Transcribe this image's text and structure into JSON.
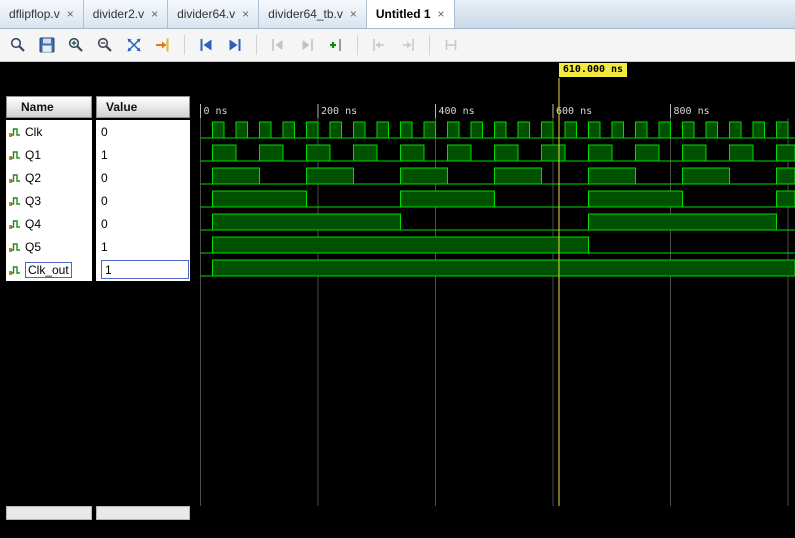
{
  "ui": {
    "close_glyph": "×"
  },
  "tabs": [
    {
      "label": "dflipflop.v",
      "active": false
    },
    {
      "label": "divider2.v",
      "active": false
    },
    {
      "label": "divider64.v",
      "active": false
    },
    {
      "label": "divider64_tb.v",
      "active": false
    },
    {
      "label": "Untitled 1",
      "active": true
    }
  ],
  "toolbar": {
    "items": [
      {
        "icon": "search-icon"
      },
      {
        "icon": "save-icon"
      },
      {
        "icon": "zoom-in-icon"
      },
      {
        "icon": "zoom-out-icon"
      },
      {
        "icon": "zoom-to-full-icon"
      },
      {
        "icon": "goto-time-cursor-icon"
      },
      {
        "sep": true
      },
      {
        "icon": "prev-transition-icon"
      },
      {
        "icon": "next-transition-icon"
      },
      {
        "sep": true
      },
      {
        "icon": "prev-marker-icon",
        "disabled": true
      },
      {
        "icon": "next-marker-icon",
        "disabled": true
      },
      {
        "icon": "add-marker-icon"
      },
      {
        "sep": true
      },
      {
        "icon": "goto-prev-cursor-icon",
        "disabled": true
      },
      {
        "icon": "goto-next-cursor-icon",
        "disabled": true
      },
      {
        "sep": true
      },
      {
        "icon": "swap-cursors-icon",
        "disabled": true
      }
    ]
  },
  "panel": {
    "name_header": "Name",
    "value_header": "Value"
  },
  "signals": [
    {
      "name": "Clk",
      "value": "0",
      "editing": false,
      "wave": {
        "init": 0,
        "first_toggle_ns": 20,
        "toggle_interval_ns": 20
      }
    },
    {
      "name": "Q1",
      "value": "1",
      "editing": false,
      "wave": {
        "init": 0,
        "first_toggle_ns": 20,
        "toggle_interval_ns": 40
      }
    },
    {
      "name": "Q2",
      "value": "0",
      "editing": false,
      "wave": {
        "init": 0,
        "first_toggle_ns": 20,
        "toggle_interval_ns": 80
      }
    },
    {
      "name": "Q3",
      "value": "0",
      "editing": false,
      "wave": {
        "init": 0,
        "first_toggle_ns": 20,
        "toggle_interval_ns": 160
      }
    },
    {
      "name": "Q4",
      "value": "0",
      "editing": false,
      "wave": {
        "init": 0,
        "first_toggle_ns": 20,
        "toggle_interval_ns": 320
      }
    },
    {
      "name": "Q5",
      "value": "1",
      "editing": false,
      "wave": {
        "init": 0,
        "first_toggle_ns": 20,
        "toggle_interval_ns": 640
      }
    },
    {
      "name": "Clk_out",
      "value": "1",
      "editing": true,
      "wave": {
        "init": 0,
        "first_toggle_ns": 20,
        "toggle_interval_ns": 1280
      }
    }
  ],
  "timeline": {
    "unit": "ns",
    "visible_start_ns": 0,
    "visible_end_ns": 1012,
    "grid_step_ns": 200,
    "ticks": [
      {
        "t": 0,
        "label": "0 ns"
      },
      {
        "t": 200,
        "label": "200 ns"
      },
      {
        "t": 400,
        "label": "400 ns"
      },
      {
        "t": 600,
        "label": "600 ns"
      },
      {
        "t": 800,
        "label": "800 ns"
      }
    ]
  },
  "cursor": {
    "time_ns": 610,
    "label": "610.000 ns"
  },
  "colors": {
    "wave_stroke": "#00dc00",
    "wave_fill": "#005200",
    "grid": "#4d4d4d",
    "tick_text": "#d8d8d8",
    "cursor_line": "#e8dc3c",
    "cursor_label_bg": "#f2ea3e",
    "selection_blue": "#4a67c8"
  }
}
